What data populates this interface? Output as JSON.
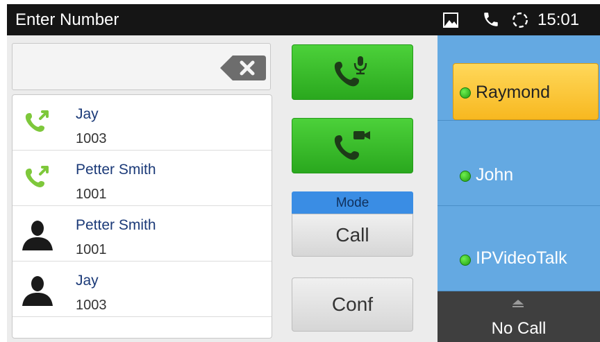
{
  "statusbar": {
    "title": "Enter Number",
    "time": "15:01"
  },
  "input": {
    "value": ""
  },
  "call_history": [
    {
      "name": "Jay",
      "number": "1003",
      "icon": "outgoing-call-icon"
    },
    {
      "name": "Petter Smith",
      "number": "1001",
      "icon": "outgoing-call-icon"
    },
    {
      "name": "Petter Smith",
      "number": "1001",
      "icon": "contact-avatar-icon"
    },
    {
      "name": "Jay",
      "number": "1003",
      "icon": "contact-avatar-icon"
    }
  ],
  "buttons": {
    "mode_label": "Mode",
    "call_mode": "Call",
    "conf": "Conf"
  },
  "lines": [
    {
      "label": "Raymond",
      "active": true
    },
    {
      "label": "John",
      "active": false
    },
    {
      "label": "IPVideoTalk",
      "active": false
    }
  ],
  "status": {
    "no_call": "No Call"
  },
  "colors": {
    "green": "#34b526",
    "accent_blue": "#3a8de4",
    "panel_blue": "#64a9e2",
    "active_yellow": "#f9c533"
  }
}
